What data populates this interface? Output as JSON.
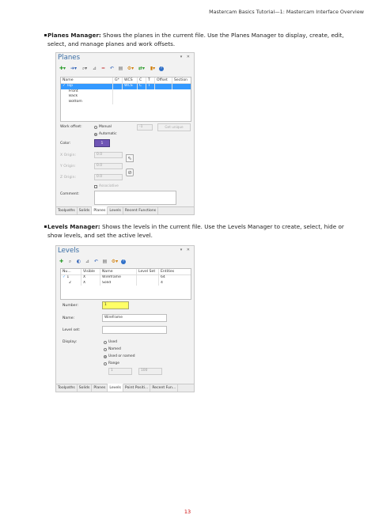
{
  "header": "Mastercam Basics Tutorial—1: Mastercam Interface Overview",
  "page_number": "13",
  "bullets": [
    {
      "title": "Planes Manager:",
      "text": " Shows the planes in the current file. Use the Planes Manager to display, create, edit, select, and manage planes and work offsets."
    },
    {
      "title": "Levels Manager:",
      "text": " Shows the levels in the current file. Use the Levels Manager to create, select, hide or show levels, and set the active level."
    }
  ],
  "planes": {
    "title": "Planes",
    "window_controls": "▾ ✕",
    "toolbar": {
      "add_icon": "✚▾",
      "select_icon": "➜▾",
      "find_icon": "⌕▾",
      "filter_icon": "⊿",
      "equal_icon": "=",
      "reset_icon": "↶",
      "save_icon": "▤",
      "settings_icon": "⚙▾",
      "refresh_icon": "⇄▾",
      "display_icon": "▮▾",
      "help_icon": "?"
    },
    "columns": [
      "Name",
      "G*",
      "WCS",
      "C",
      "T",
      "Offset",
      "Section"
    ],
    "rows": [
      {
        "check": "✓",
        "name": "Top",
        "g": "",
        "wcs": "WCS",
        "c": "C",
        "t": "T",
        "offset": "",
        "section": ""
      },
      {
        "check": "",
        "name": "Front",
        "g": "",
        "wcs": "",
        "c": "",
        "t": "",
        "offset": "",
        "section": ""
      },
      {
        "check": "",
        "name": "Back",
        "g": "",
        "wcs": "",
        "c": "",
        "t": "",
        "offset": "",
        "section": ""
      },
      {
        "check": "",
        "name": "Bottom",
        "g": "",
        "wcs": "",
        "c": "",
        "t": "",
        "offset": "",
        "section": ""
      }
    ],
    "work_offset_label": "Work offset:",
    "manual_label": "Manual",
    "automatic_label": "Automatic",
    "offset_value": "-1",
    "get_unique_label": "Get unique",
    "color_label": "Color:",
    "color_value": "1",
    "x_origin_label": "X Origin:",
    "y_origin_label": "Y Origin:",
    "z_origin_label": "Z Origin:",
    "x_origin_value": "0.0",
    "y_origin_value": "0.0",
    "z_origin_value": "0.0",
    "associative_label": "Associative",
    "comment_label": "Comment:",
    "tabs": [
      "Toolpaths",
      "Solids",
      "Planes",
      "Levels",
      "Recent Functions"
    ],
    "active_tab": 2,
    "accent": "#3399ff",
    "swatch_color": "#6f55b5"
  },
  "levels": {
    "title": "Levels",
    "window_controls": "▾ ✕",
    "toolbar": {
      "add_icon": "✚",
      "find_icon": "⌕",
      "visible_icon": "◐",
      "filter_icon": "⊿",
      "reset_icon": "↶",
      "save_icon": "▤",
      "settings_icon": "⚙▾",
      "help_icon": "?"
    },
    "columns": [
      "Nu...",
      "Visible",
      "Name",
      "Level Set",
      "Entities"
    ],
    "rows": [
      {
        "check": "✓",
        "number": "1",
        "visible": "X",
        "name": "Wireframe",
        "level_set": "",
        "entities": "64"
      },
      {
        "check": "",
        "number": "2",
        "visible": "X",
        "name": "Solid",
        "level_set": "",
        "entities": "4"
      }
    ],
    "number_label": "Number:",
    "number_value": "1",
    "name_label": "Name:",
    "name_value": "Wireframe",
    "level_set_label": "Level set:",
    "level_set_value": "",
    "display_label": "Display:",
    "used_label": "Used",
    "named_label": "Named",
    "used_or_named_label": "Used or named",
    "range_label": "Range",
    "range_from": "1",
    "range_to": "100",
    "tabs": [
      "Toolpaths",
      "Solids",
      "Planes",
      "Levels",
      "Point Positi...",
      "Recent Fun..."
    ],
    "active_tab": 3,
    "number_highlight": "#ffff66"
  }
}
